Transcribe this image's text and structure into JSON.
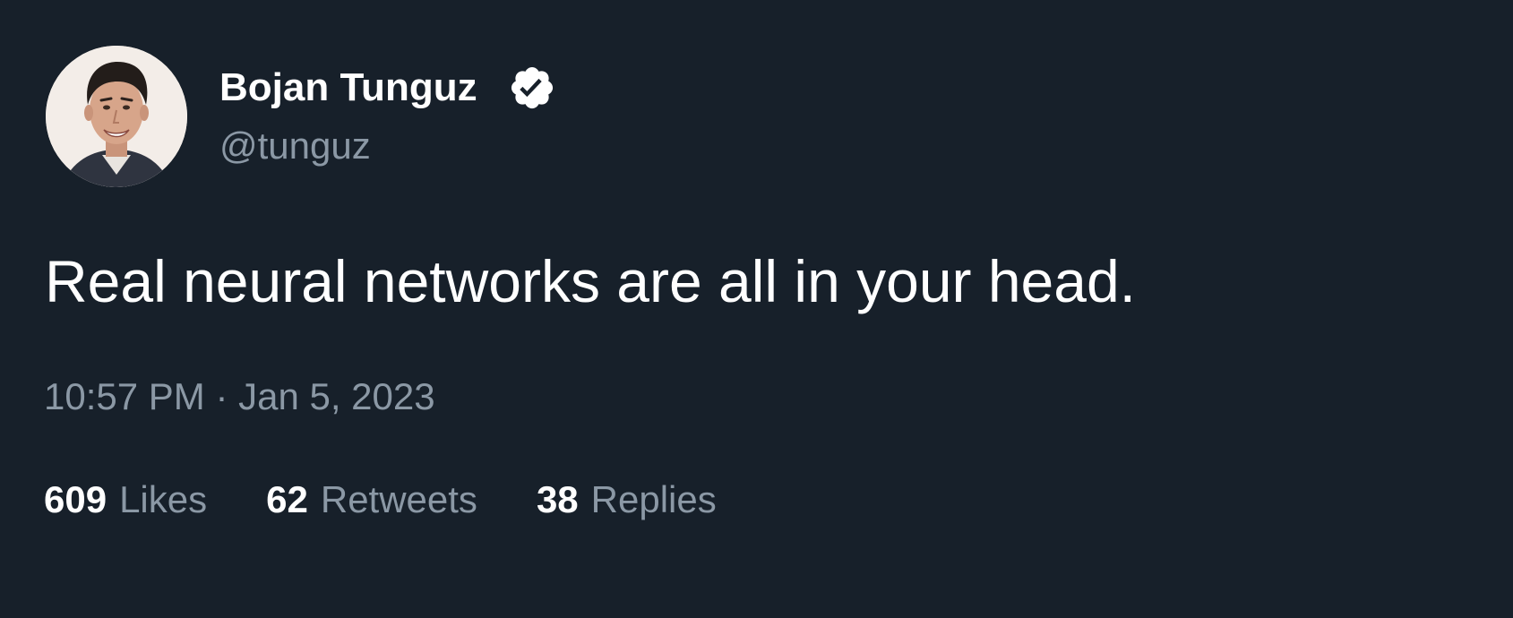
{
  "author": {
    "name": "Bojan Tunguz",
    "handle": "@tunguz",
    "verified": true,
    "avatar_icon": "profile-photo"
  },
  "tweet": {
    "text": "Real neural networks are all in your head.",
    "timestamp": "10:57 PM · Jan 5, 2023"
  },
  "stats": {
    "likes": {
      "count": "609",
      "label": "Likes"
    },
    "retweets": {
      "count": "62",
      "label": "Retweets"
    },
    "replies": {
      "count": "38",
      "label": "Replies"
    }
  },
  "colors": {
    "background": "#17202a",
    "primary_text": "#ffffff",
    "secondary_text": "#8b98a5",
    "verified_badge": "#ffffff"
  }
}
